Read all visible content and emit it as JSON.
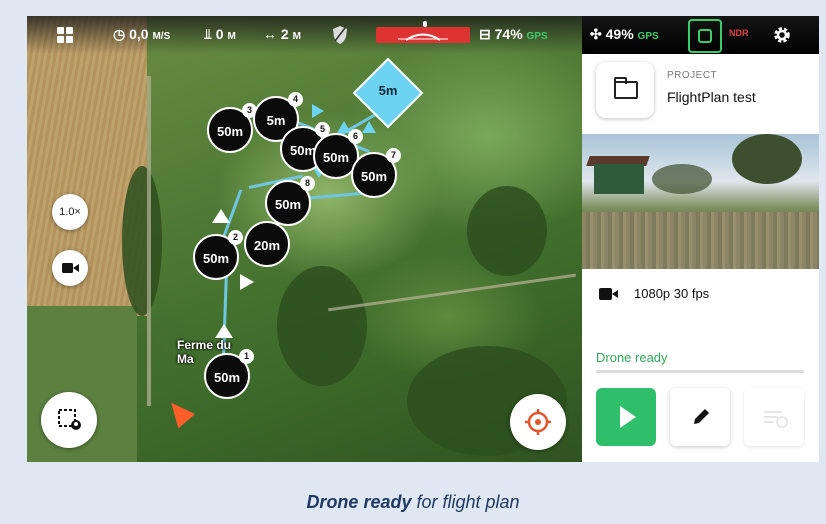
{
  "statusbar": {
    "speed": "0,0",
    "speed_unit": "M/S",
    "altitude": "0",
    "altitude_unit": "M",
    "distance": "2",
    "distance_unit": "M",
    "controller_battery": "74%",
    "gps_label": "GPS",
    "drone_battery": "49%",
    "gps_label_2": "GPS",
    "ndr_label": "NDR"
  },
  "project": {
    "label": "PROJECT",
    "name": "FlightPlan test"
  },
  "video": {
    "spec": "1080p 30 fps"
  },
  "status": {
    "text": "Drone ready"
  },
  "map": {
    "zoom": "1.0×",
    "place_line1": "Ferme du",
    "place_line2": "Ma",
    "poi_altitude": "5m",
    "waypoints": [
      {
        "num": "1",
        "label": "50m"
      },
      {
        "num": "2",
        "label": "50m"
      },
      {
        "num": "3",
        "label": "50m"
      },
      {
        "num": "4",
        "label": "5m"
      },
      {
        "num": "5",
        "label": "50m"
      },
      {
        "num": "6",
        "label": "50m"
      },
      {
        "num": "7",
        "label": "50m"
      },
      {
        "num": "8",
        "label": "50m"
      },
      {
        "num": "",
        "label": "20m"
      }
    ]
  },
  "caption": {
    "bold": "Drone ready",
    "rest": " for flight plan"
  },
  "colors": {
    "accent_green": "#2fbe6a",
    "poi_blue": "#6dd3f2",
    "home_orange": "#ff5e2b"
  },
  "icons": [
    "grid-icon",
    "speed-gauge-icon",
    "altitude-icon",
    "distance-icon",
    "shield-icon",
    "controller-icon",
    "drone-icon",
    "camera-record-icon",
    "settings-gear-icon",
    "folder-icon",
    "video-camera-icon",
    "play-icon",
    "pencil-icon",
    "waypoints-icon",
    "locate-icon",
    "home-arrow-icon"
  ]
}
